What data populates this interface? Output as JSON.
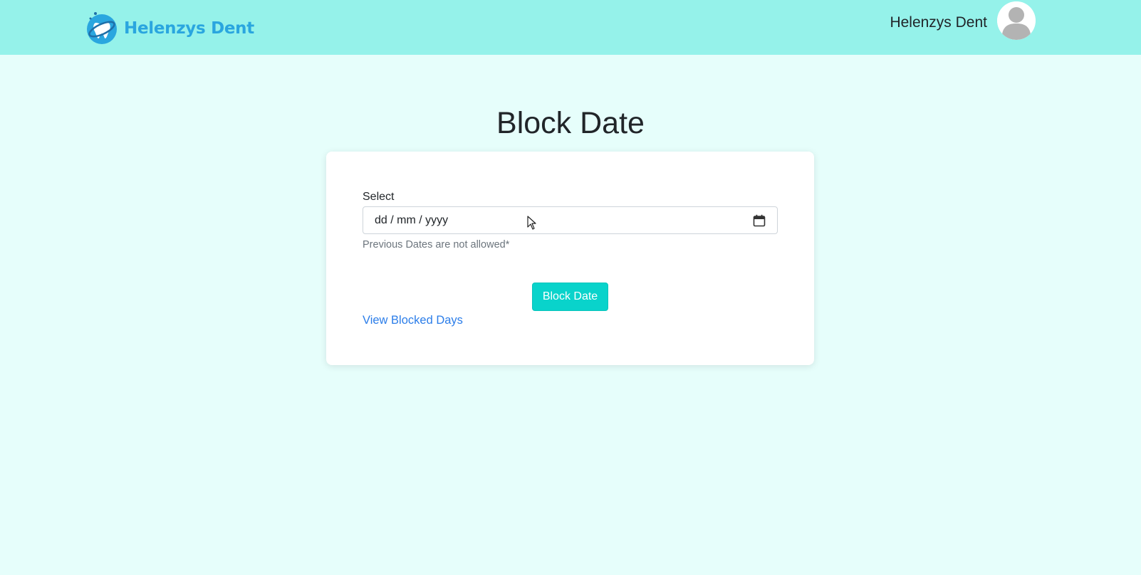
{
  "navbar": {
    "brand_name": "Helenzys Dent",
    "user_name": "Helenzys Dent",
    "avatar_icon": "user-avatar-icon",
    "background_color": "#95f2ea"
  },
  "page": {
    "title": "Block Date",
    "background_color": "#e6fefb"
  },
  "form": {
    "label": "Select",
    "date_placeholder": "dd / mm / yyyy",
    "calendar_icon": "calendar-icon",
    "help_text": "Previous Dates are not allowed*",
    "submit_label": "Block Date",
    "submit_color": "#09d3cb",
    "view_link_label": "View Blocked Days",
    "link_color": "#2b7de9"
  }
}
